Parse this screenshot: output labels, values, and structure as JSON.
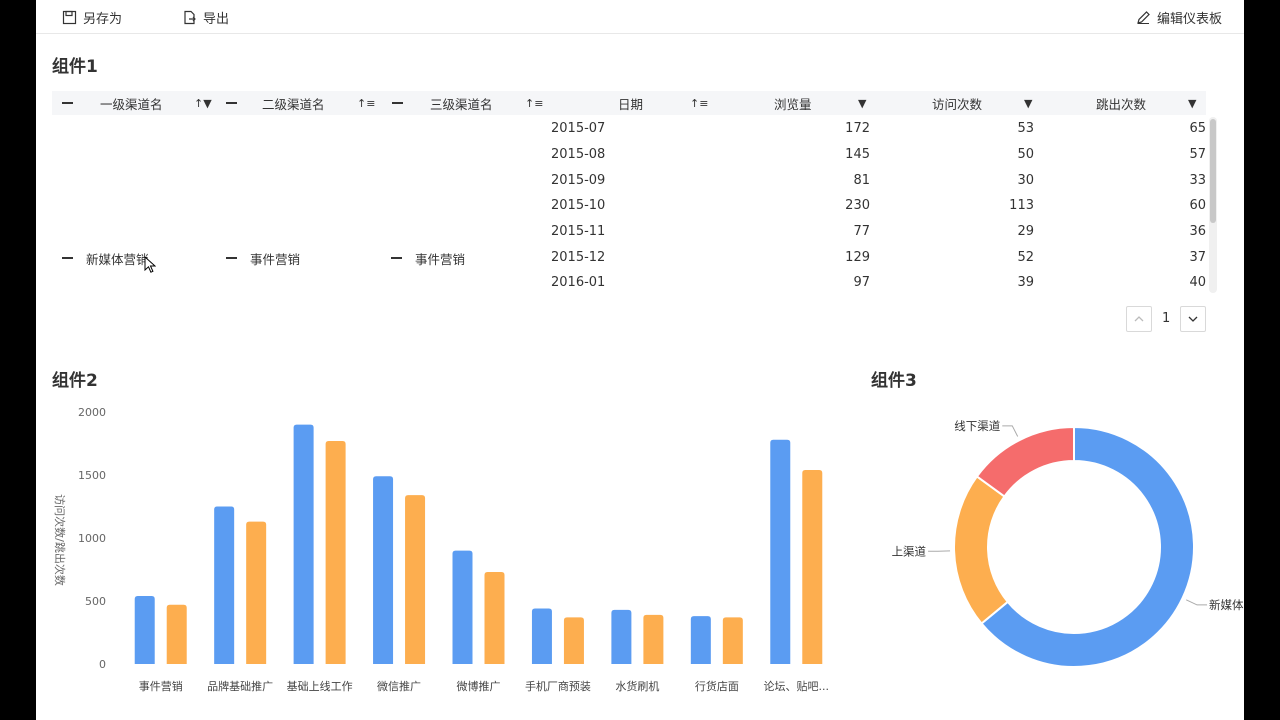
{
  "toolbar": {
    "save_as": "另存为",
    "export": "导出",
    "edit_dashboard": "编辑仪表板"
  },
  "widget1": {
    "title": "组件1",
    "columns": {
      "level1": "一级渠道名",
      "level2": "二级渠道名",
      "level3": "三级渠道名",
      "date": "日期",
      "views": "浏览量",
      "visits": "访问次数",
      "bounces": "跳出次数"
    },
    "dims": {
      "level1": "新媒体营销",
      "level2": "事件营销",
      "level3": "事件营销"
    },
    "rows": [
      {
        "date": "2015-07",
        "views": "172",
        "visits": "53",
        "bounces": "65"
      },
      {
        "date": "2015-08",
        "views": "145",
        "visits": "50",
        "bounces": "57"
      },
      {
        "date": "2015-09",
        "views": "81",
        "visits": "30",
        "bounces": "33"
      },
      {
        "date": "2015-10",
        "views": "230",
        "visits": "113",
        "bounces": "60"
      },
      {
        "date": "2015-11",
        "views": "77",
        "visits": "29",
        "bounces": "36"
      },
      {
        "date": "2015-12",
        "views": "129",
        "visits": "52",
        "bounces": "37"
      },
      {
        "date": "2016-01",
        "views": "97",
        "visits": "39",
        "bounces": "40"
      }
    ],
    "pager": {
      "page": "1"
    }
  },
  "widget2": {
    "title": "组件2"
  },
  "widget3": {
    "title": "组件3"
  },
  "chart_data": [
    {
      "type": "bar",
      "ylabel": "访问次数/跳出次数",
      "ylim": [
        0,
        2000
      ],
      "yticks": [
        0,
        500,
        1000,
        1500,
        2000
      ],
      "categories": [
        "事件营销",
        "品牌基础推广",
        "基础上线工作",
        "微信推广",
        "微博推广",
        "手机厂商预装",
        "水货刷机",
        "行货店面",
        "论坛、贴吧..."
      ],
      "series": [
        {
          "name": "访问次数",
          "color": "#5b9cf2",
          "values": [
            540,
            1250,
            1900,
            1490,
            900,
            440,
            430,
            380,
            1780
          ]
        },
        {
          "name": "跳出次数",
          "color": "#fdae4f",
          "values": [
            470,
            1130,
            1770,
            1340,
            730,
            370,
            390,
            370,
            1540
          ]
        }
      ],
      "grid": false
    },
    {
      "type": "pie",
      "labels": [
        "新媒体营",
        "上渠道",
        "线下渠道"
      ],
      "values": [
        64,
        21,
        15
      ],
      "colors": [
        "#5b9cf2",
        "#fdae4f",
        "#f56c6c"
      ],
      "donut": true
    }
  ]
}
